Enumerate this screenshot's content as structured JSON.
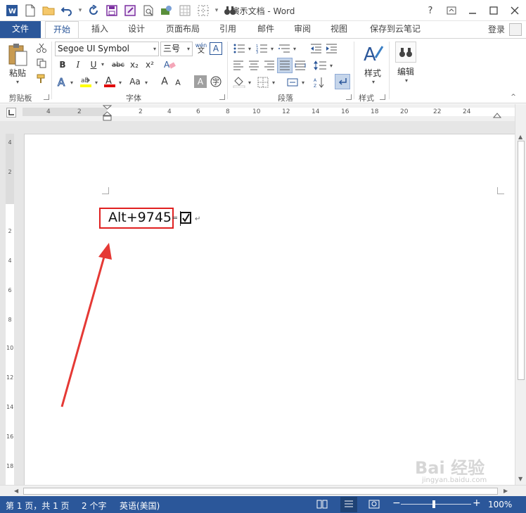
{
  "window": {
    "title": "演示文档 - Word",
    "help": "?",
    "colors": {
      "brand": "#2b579a",
      "highlight": "#e02020",
      "arrow": "#e53935"
    }
  },
  "tabs": {
    "file": "文件",
    "items": [
      "开始",
      "插入",
      "设计",
      "页面布局",
      "引用",
      "邮件",
      "审阅",
      "视图",
      "保存到云笔记"
    ],
    "active": "开始",
    "login": "登录"
  },
  "ribbon": {
    "clipboard": {
      "paste": "粘贴",
      "label": "剪贴板"
    },
    "font": {
      "name": "Segoe UI Symbol",
      "size": "三号",
      "phonetic": "wén",
      "bold": "B",
      "italic": "I",
      "underline": "U",
      "strike": "abc",
      "subscript": "x₂",
      "superscript": "x²",
      "font_color": "A",
      "case": "Aa",
      "grow": "A",
      "shrink": "A",
      "label": "字体"
    },
    "paragraph": {
      "label": "段落"
    },
    "styles": {
      "styles_btn": "样式",
      "label": "样式"
    },
    "editing": {
      "edit_btn": "编辑"
    }
  },
  "ruler": {
    "numbers": [
      "4",
      "2",
      "2",
      "4",
      "6",
      "8",
      "10",
      "12",
      "14",
      "16",
      "18",
      "20",
      "22",
      "24"
    ]
  },
  "vruler": {
    "numbers": [
      "4",
      "2",
      "2",
      "4",
      "6",
      "8",
      "10",
      "12",
      "14",
      "16",
      "18"
    ]
  },
  "document": {
    "text": "Alt+9745",
    "symbol": "☑"
  },
  "status": {
    "page": "第 1 页，共 1 页",
    "words": "2 个字",
    "language": "英语(美国)",
    "zoom": "100%",
    "zoom_minus": "−",
    "zoom_plus": "+"
  },
  "watermark": {
    "main": "Bai 经验",
    "sub": "jingyan.baidu.com"
  }
}
